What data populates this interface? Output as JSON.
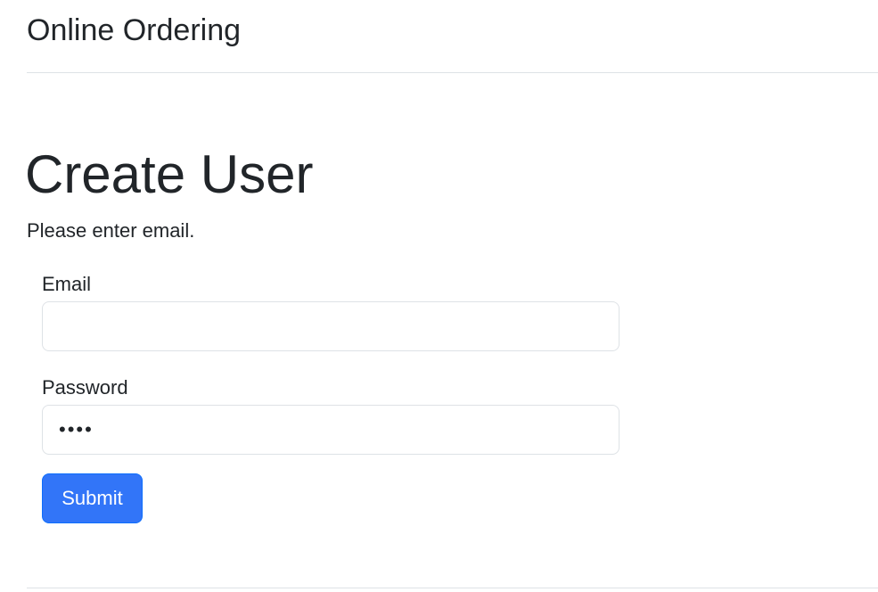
{
  "header": {
    "brand": "Online Ordering"
  },
  "main": {
    "title": "Create User",
    "message": "Please enter email."
  },
  "form": {
    "email": {
      "label": "Email",
      "value": "",
      "placeholder": ""
    },
    "password": {
      "label": "Password",
      "value": "••••"
    },
    "submit_label": "Submit"
  },
  "colors": {
    "primary": "#3275f8",
    "text": "#212529",
    "border": "#dee2e6"
  }
}
